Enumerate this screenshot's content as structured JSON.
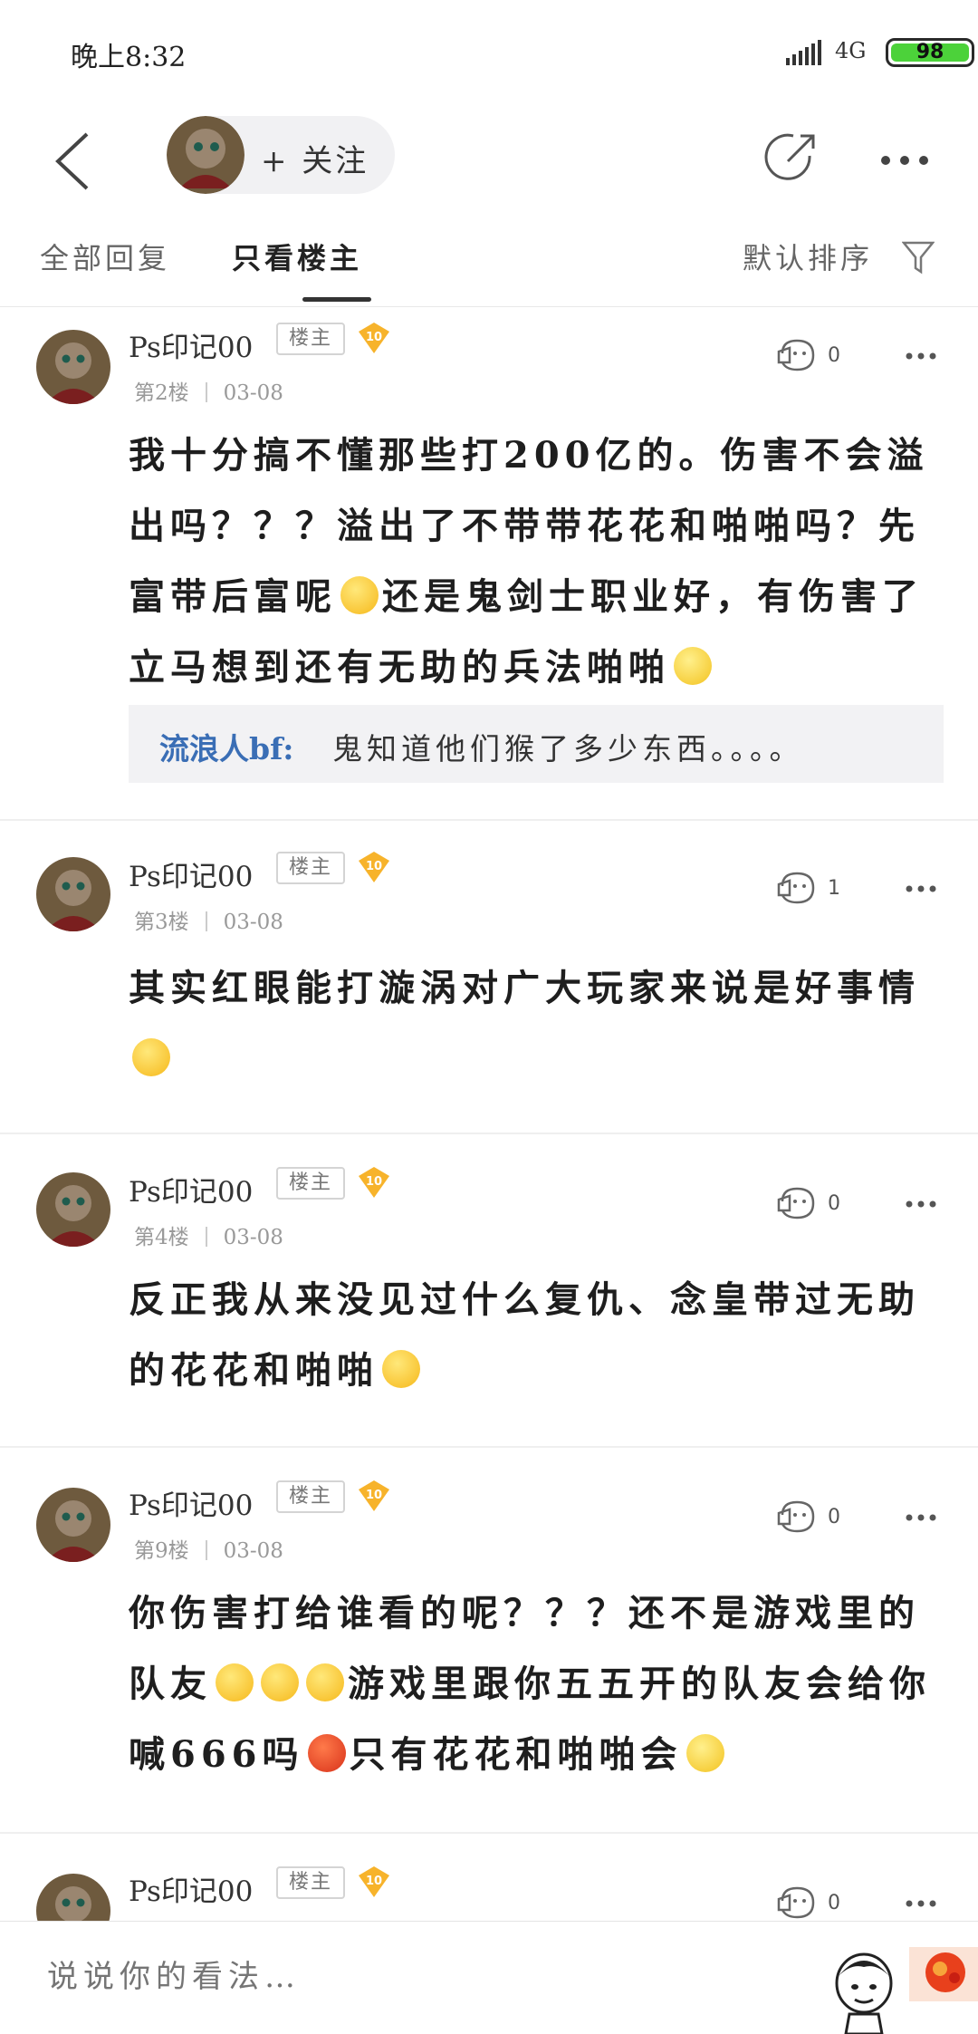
{
  "status_bar": {
    "time": "晚上8:32",
    "network": "4G",
    "battery": "98"
  },
  "header": {
    "follow_label": "+ 关注"
  },
  "tabs": {
    "all_replies": "全部回复",
    "only_owner": "只看楼主",
    "sort": "默认排序"
  },
  "posts": [
    {
      "username": "Ps印记00",
      "badge": "楼主",
      "level": "10",
      "floor": "第2楼",
      "date": "03-08",
      "likes": "0",
      "text_parts": [
        "我十分搞不懂那些打200亿的。伤害不会溢出吗？？？溢出了不带带花花和啪啪吗？先富带后富呢",
        "还是鬼剑士职业好，有伤害了立马想到还有无助的兵法啪啪",
        ""
      ],
      "reply": {
        "name": "流浪人bf:",
        "text": "鬼知道他们猴了多少东西。。。。"
      }
    },
    {
      "username": "Ps印记00",
      "badge": "楼主",
      "level": "10",
      "floor": "第3楼",
      "date": "03-08",
      "likes": "1",
      "text_parts": [
        "其实红眼能打漩涡对广大玩家来说是好事情",
        ""
      ]
    },
    {
      "username": "Ps印记00",
      "badge": "楼主",
      "level": "10",
      "floor": "第4楼",
      "date": "03-08",
      "likes": "0",
      "text_parts": [
        "反正我从来没见过什么复仇、念皇带过无助的花花和啪啪",
        ""
      ]
    },
    {
      "username": "Ps印记00",
      "badge": "楼主",
      "level": "10",
      "floor": "第9楼",
      "date": "03-08",
      "likes": "0",
      "text_parts": [
        "你伤害打给谁看的呢？？？还不是游戏里的队友",
        "",
        "",
        "游戏里跟你五五开的队友会给你喊666吗",
        "只有花花和啪啪会",
        ""
      ]
    },
    {
      "username": "Ps印记00",
      "badge": "楼主",
      "level": "10",
      "likes": "0"
    }
  ],
  "bottom": {
    "input_placeholder": "说说你的看法…"
  },
  "colors": {
    "accent_blue": "#3a6eb5",
    "battery_green": "#4cd23a",
    "level_gold": "#f7b32b"
  }
}
